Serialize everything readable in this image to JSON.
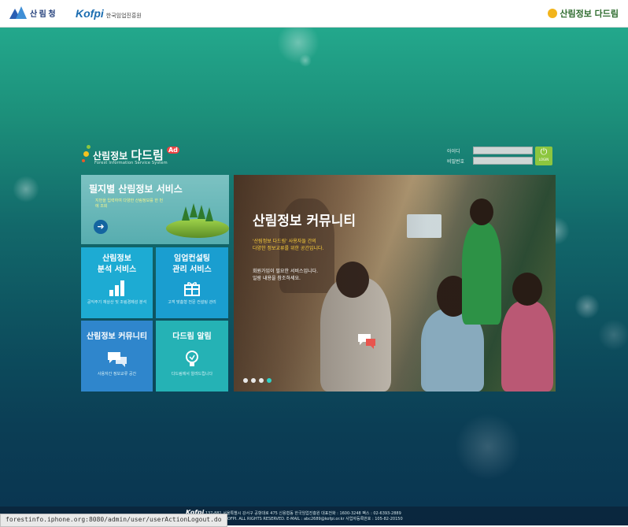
{
  "header": {
    "ministry_logo_text": "산 림 청",
    "kofpi_brand": "Kofpi",
    "kofpi_name": "한국임업진흥원",
    "service_logo_text": "산림정보 다드림"
  },
  "brand": {
    "name_prefix": "산림정보",
    "name_main": "다드림",
    "badge": "Ad",
    "subtitle": "Forest Information Service System"
  },
  "login": {
    "id_label": "아이디",
    "password_label": "비밀번호",
    "button_label": "LOGIN"
  },
  "tiles": {
    "main": {
      "title": "필지별 산림정보 서비스",
      "desc": "지번을 입력하여 다양한 산림정보를 한 번에 조회"
    },
    "analysis": {
      "title1": "산림정보",
      "title2": "분석 서비스",
      "desc": "공익주기 재상산 및 조림경제성 분석"
    },
    "consulting": {
      "title1": "임업컨설팅",
      "title2": "관리 서비스",
      "desc": "고객 맞춤형 전문 컨설팅 관리"
    },
    "community": {
      "title": "산림정보 커뮤니티",
      "desc": "사용자간 정보교류 공간"
    },
    "alert": {
      "title": "다드림 알림",
      "desc": "다드림에서 알려드립니다"
    }
  },
  "hero": {
    "title": "산림정보 커뮤니티",
    "yellow_line1": "'산림정보 다드림' 사용자들 간의",
    "yellow_line2": "다양한 정보교류를 위한 공간입니다.",
    "white_line1": "회원가입이 필요한 서비스입니다.",
    "white_line2": "일람 내용을 참조하세요."
  },
  "footer": {
    "brand": "Kofpi",
    "line1": "137-881 서울특별시 강서구 공항대로 475 신용협동 한국임업진흥원 대표전화 : 1600-3248 팩스 : 02-6393-2889",
    "line2": "COPYRIGHT© 2013 KOFPI. ALL RIGHTS RESERVED. E-MAIL : abc2689@kofpi.or.kr 사업자등록번호 : 105-82-20150"
  },
  "status_bar": {
    "url": "forestinfo.iphone.org:8080/admin/user/userActionLogout.do"
  }
}
